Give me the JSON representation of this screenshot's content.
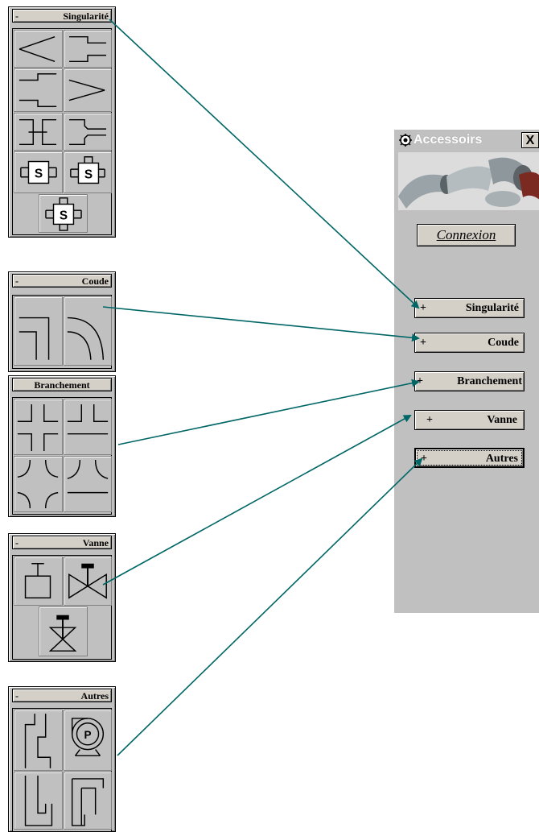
{
  "window": {
    "title": "Accessoirs",
    "close_label": "X",
    "header_label": "Connexion",
    "buttons": [
      {
        "sign": "+",
        "label": "Singularité"
      },
      {
        "sign": "+",
        "label": "Coude"
      },
      {
        "sign": "+",
        "label": "Branchement"
      },
      {
        "sign": "+",
        "label": "Vanne"
      },
      {
        "sign": "+",
        "label": "Autres"
      }
    ]
  },
  "panels": {
    "singularite": {
      "sign": "-",
      "label": "Singularité"
    },
    "coude": {
      "sign": "-",
      "label": "Coude"
    },
    "branchement": {
      "sign": "",
      "label": "Branchement"
    },
    "vanne": {
      "sign": "-",
      "label": "Vanne"
    },
    "autres": {
      "sign": "-",
      "label": "Autres"
    }
  },
  "symbols": {
    "s_box": "S",
    "pump": "P"
  },
  "colors": {
    "arrow": "#006666",
    "panel": "#c0c0c0"
  }
}
